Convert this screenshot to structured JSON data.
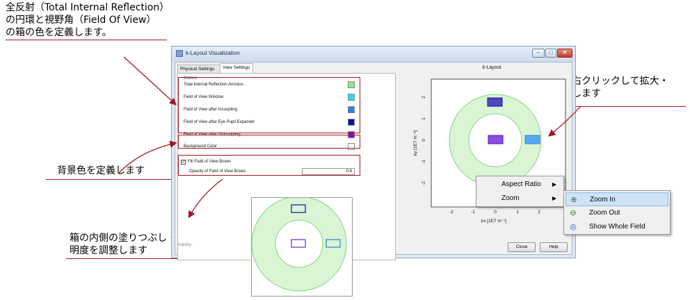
{
  "callouts": {
    "tir": [
      "全反射（Total Internal Reflection）",
      "の円環と視野角（Field Of View）",
      "の箱の色を定義します。"
    ],
    "zoom": [
      "図を右クリックして拡大・",
      "縮小します"
    ],
    "background": "背景色を定義します",
    "fill": [
      "箱の内側の塗りつぶし・消去、不透",
      "明度を調整します"
    ]
  },
  "window": {
    "title": "k-Layout Visualization",
    "tabs": [
      "Physical Settings",
      "View Settings"
    ],
    "colors_group": "Colors",
    "color_rows": [
      {
        "label": "Total Internal Reflection Annulus",
        "color": "#8ee68e"
      },
      {
        "label": "Field of View Window",
        "color": "#22e0f0"
      },
      {
        "label": "Field of View after Incoupling",
        "color": "#2f7fe0"
      },
      {
        "label": "Field of View after Eye Pupil Expander",
        "color": "#1010a0"
      },
      {
        "label": "Field of View after Outcoupling",
        "color": "#7b10d8"
      }
    ],
    "background_row": {
      "label": "Background Color",
      "color": "#ffffff"
    },
    "fill_checkbox": {
      "label": "Fill Field of View Boxes",
      "checked": true,
      "mark": "✓"
    },
    "opacity": {
      "label": "Opacity of Field of View Boxes",
      "value": "0.6"
    },
    "validity": "Validity:",
    "buttons": {
      "close": "Close",
      "help": "Help"
    }
  },
  "plot": {
    "title": "k-Layout",
    "xlabel": "kx [1E7 m⁻¹]",
    "ylabel": "ky [1E7 m⁻¹]",
    "xticks": [
      "-2",
      "-1",
      "0",
      "1",
      "2"
    ],
    "yticks": [
      "2",
      "1",
      "0",
      "-1",
      "-2"
    ],
    "annulus_color": "#d9f5d4",
    "annulus_stroke": "#7fd67f"
  },
  "context_menu": {
    "items": [
      {
        "label": "Aspect Ratio",
        "arrow": "▶"
      },
      {
        "label": "Zoom",
        "arrow": "▶"
      }
    ],
    "submenu": [
      {
        "label": "Zoom In",
        "icon": "zoom-in-icon",
        "glyph": "⊕"
      },
      {
        "label": "Zoom Out",
        "icon": "zoom-out-icon",
        "glyph": "⊖"
      },
      {
        "label": "Show Whole Field",
        "icon": "whole-field-icon",
        "glyph": "◎"
      }
    ]
  }
}
